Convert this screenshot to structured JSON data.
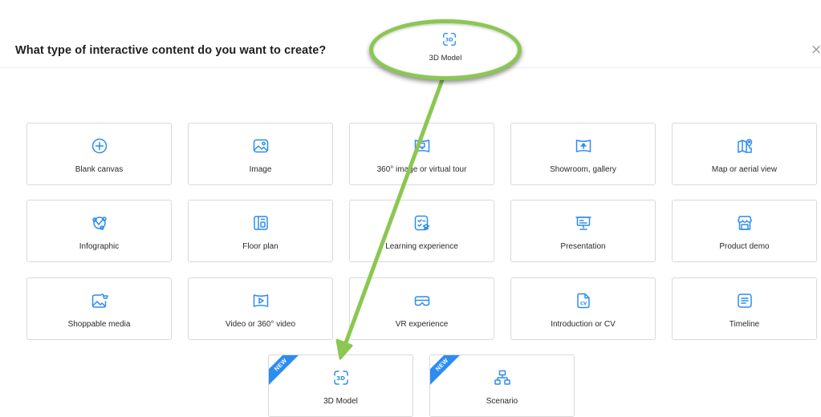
{
  "dialog": {
    "title": "What type of interactive content do you want to create?",
    "close_label": "×"
  },
  "cards": [
    {
      "label": "Blank canvas",
      "icon": "plus-circle-icon"
    },
    {
      "label": "Image",
      "icon": "image-icon"
    },
    {
      "label": "360° image or virtual tour",
      "icon": "panorama-icon"
    },
    {
      "label": "Showroom, gallery",
      "icon": "showroom-icon"
    },
    {
      "label": "Map or aerial view",
      "icon": "map-icon"
    },
    {
      "label": "Infographic",
      "icon": "infographic-icon"
    },
    {
      "label": "Floor plan",
      "icon": "floor-plan-icon"
    },
    {
      "label": "Learning experience",
      "icon": "learning-icon"
    },
    {
      "label": "Presentation",
      "icon": "presentation-icon"
    },
    {
      "label": "Product demo",
      "icon": "store-icon"
    },
    {
      "label": "Shoppable media",
      "icon": "shoppable-icon"
    },
    {
      "label": "Video or 360° video",
      "icon": "video-icon"
    },
    {
      "label": "VR experience",
      "icon": "vr-headset-icon"
    },
    {
      "label": "Introduction or CV",
      "icon": "cv-document-icon"
    },
    {
      "label": "Timeline",
      "icon": "timeline-icon"
    },
    {
      "label": "3D Model",
      "icon": "3d-model-icon",
      "badge": "NEW"
    },
    {
      "label": "Scenario",
      "icon": "scenario-icon",
      "badge": "NEW"
    }
  ],
  "callout": {
    "label": "3D Model",
    "icon": "3d-model-icon"
  },
  "colors": {
    "accent": "#2d8cf0",
    "highlight": "#8bc751",
    "border": "#d9d9d9"
  }
}
